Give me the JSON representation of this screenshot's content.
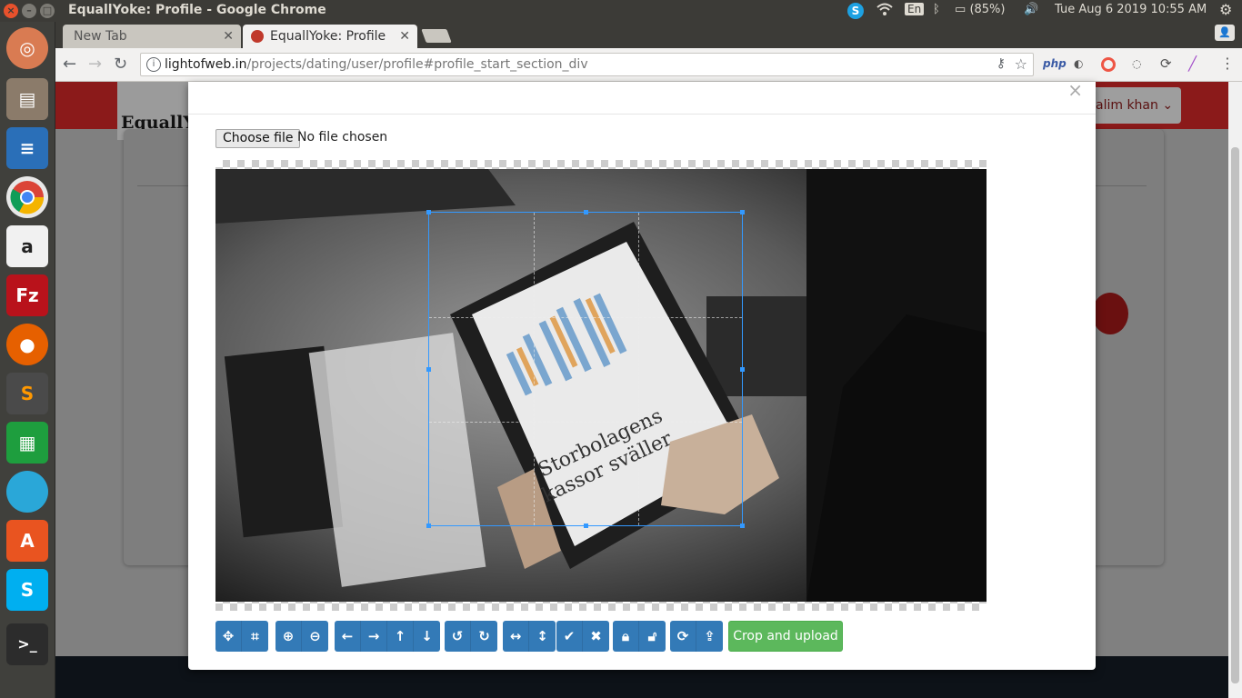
{
  "system": {
    "window_title": "EquallYoke: Profile - Google Chrome",
    "language": "En",
    "battery": "(85%)",
    "clock": "Tue Aug  6 2019 10:55 AM"
  },
  "browser": {
    "tabs": [
      {
        "label": "New Tab"
      },
      {
        "label": "EquallYoke: Profile"
      }
    ],
    "url_host": "lightofweb.in",
    "url_path": "/projects/dating/user/profile#profile_start_section_div",
    "extensions": [
      "php"
    ]
  },
  "page": {
    "logo_text": "EquallY",
    "user_name": "alim khan"
  },
  "modal": {
    "close": "×",
    "file_button": "Choose file",
    "file_status": "No file chosen",
    "crop_upload_label": "Crop and upload",
    "toolbar_groups": [
      [
        "move-icon",
        "crop-icon"
      ],
      [
        "zoom-in-icon",
        "zoom-out-icon"
      ],
      [
        "arrow-left-icon",
        "arrow-right-icon",
        "arrow-up-icon",
        "arrow-down-icon"
      ],
      [
        "rotate-left-icon",
        "rotate-right-icon"
      ],
      [
        "flip-horizontal-icon",
        "flip-vertical-icon"
      ],
      [
        "check-icon",
        "clear-icon"
      ],
      [
        "lock-icon",
        "unlock-icon"
      ],
      [
        "reset-icon",
        "upload-icon"
      ]
    ],
    "colors": {
      "primary": "#337ab7",
      "success": "#5cb85c",
      "crop_border": "#3399ff"
    }
  }
}
